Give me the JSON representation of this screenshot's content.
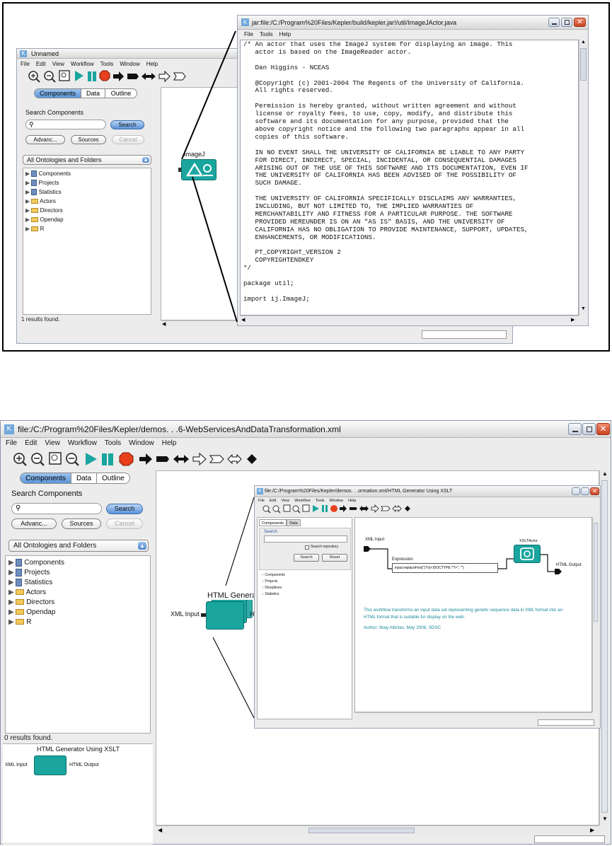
{
  "top": {
    "unnamed": {
      "title": "Unnamed",
      "menu": [
        "File",
        "Edit",
        "View",
        "Workflow",
        "Tools",
        "Window",
        "Help"
      ],
      "tabs": [
        "Components",
        "Data",
        "Outline"
      ],
      "search_label": "Search Components",
      "search_button": "Search",
      "advanced_button": "Advanc...",
      "sources_button": "Sources",
      "cancel_button": "Cancel",
      "ontology_select": "All Ontologies and Folders",
      "tree": [
        "Components",
        "Projects",
        "Statistics",
        "Actors",
        "Directors",
        "Opendap",
        "R"
      ],
      "status": "1 results found.",
      "actor_label": "ImageJ"
    },
    "editor": {
      "title": "jar:file:/C:/Program%20Files/Kepler/build/kepler.jar!/util/ImageJActor.java",
      "menu": [
        "File",
        "Tools",
        "Help"
      ],
      "lines": [
        "/* An actor that uses the ImageJ system for displaying an image. This",
        "   actor is based on the ImageReader actor.",
        "",
        "   Dan Higgins - NCEAS",
        "",
        "   @Copyright (c) 2001-2004 The Regents of the University of California.",
        "   All rights reserved.",
        "",
        "   Permission is hereby granted, without written agreement and without",
        "   license or royalty fees, to use, copy, modify, and distribute this",
        "   software and its documentation for any purpose, provided that the",
        "   above copyright notice and the following two paragraphs appear in all",
        "   copies of this software.",
        "",
        "   IN NO EVENT SHALL THE UNIVERSITY OF CALIFORNIA BE LIABLE TO ANY PARTY",
        "   FOR DIRECT, INDIRECT, SPECIAL, INCIDENTAL, OR CONSEQUENTIAL DAMAGES",
        "   ARISING OUT OF THE USE OF THIS SOFTWARE AND ITS DOCUMENTATION, EVEN IF",
        "   THE UNIVERSITY OF CALIFORNIA HAS BEEN ADVISED OF THE POSSIBILITY OF",
        "   SUCH DAMAGE.",
        "",
        "   THE UNIVERSITY OF CALIFORNIA SPECIFICALLY DISCLAIMS ANY WARRANTIES,",
        "   INCLUDING, BUT NOT LIMITED TO, THE IMPLIED WARRANTIES OF",
        "   MERCHANTABILITY AND FITNESS FOR A PARTICULAR PURPOSE. THE SOFTWARE",
        "   PROVIDED HEREUNDER IS ON AN \"AS IS\" BASIS, AND THE UNIVERSITY OF",
        "   CALIFORNIA HAS NO OBLIGATION TO PROVIDE MAINTENANCE, SUPPORT, UPDATES,",
        "   ENHANCEMENTS, OR MODIFICATIONS.",
        "",
        "   PT_COPYRIGHT_VERSION 2",
        "   COPYRIGHTENDKEY",
        "*/",
        "",
        "package util;",
        "",
        "import ij.ImageJ;"
      ]
    }
  },
  "bottom": {
    "main": {
      "title": "file:/C:/Program%20Files/Kepler/demos. . .6-WebServicesAndDataTransformation.xml",
      "menu": [
        "File",
        "Edit",
        "View",
        "Workflow",
        "Tools",
        "Window",
        "Help"
      ],
      "tabs": [
        "Components",
        "Data",
        "Outline"
      ],
      "search_label": "Search Components",
      "search_button": "Search",
      "advanced_button": "Advanc...",
      "sources_button": "Sources",
      "cancel_button": "Cancel",
      "ontology_select": "All Ontologies and Folders",
      "tree": [
        "Components",
        "Projects",
        "Statistics",
        "Actors",
        "Directors",
        "Opendap",
        "R"
      ],
      "status": "0 results found.",
      "mini_title": "HTML Generator Using XSLT",
      "mini_in": "XML Input",
      "mini_out": "HTML Output",
      "actor_label": "HTML Genera",
      "actor_in": "XML Input",
      "actor_out": "H"
    },
    "inner": {
      "title": "file:/C:/Program%20Files/Kepler/demos. . .ormation.xml/HTML Generator Using XSLT",
      "menu": [
        "File",
        "Edit",
        "View",
        "Workflow",
        "Tools",
        "Window",
        "Help"
      ],
      "tabs": [
        "Components",
        "Data"
      ],
      "search_label": "Search",
      "search_repository": "Search repository",
      "search_button": "Search",
      "reset_button": "Reset",
      "tree": [
        "Components",
        "Projects",
        "Disciplines",
        "Statistics"
      ],
      "xml_input": "XML Input",
      "expression_label": "Expression",
      "expression_value": "input.replaceFirst(\"(?s)<!DOCTYPE.*?>\", \"\")",
      "xslt_actor": "XSLTActor",
      "html_output": "HTML Output",
      "description": "This workflow transforms an input data set representing genetic sequence data in XML format into an HTML format that is suitable for display on the web.",
      "author": "Author: Ilkay Altintas, May 2006, SDSC"
    }
  },
  "colors": {
    "accent": "#1aa59f",
    "play": "#1aa59f",
    "stop": "#e8401c",
    "tab_selected": "#5c95d6"
  }
}
